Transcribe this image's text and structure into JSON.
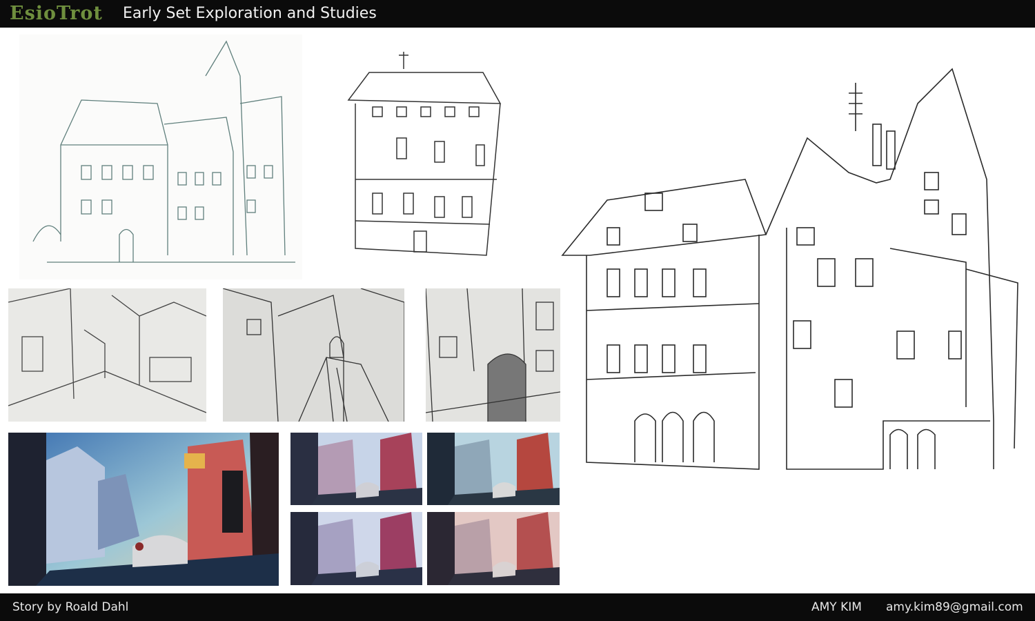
{
  "header": {
    "logo": "EsioTrot",
    "title": "Early Set Exploration and Studies"
  },
  "footer": {
    "credit": "Story by Roald Dahl",
    "author": "AMY KIM",
    "email": "amy.kim89@gmail.com"
  },
  "colors": {
    "bar": "#0b0b0b",
    "logo": "#6f8f3e",
    "text": "#f2f2f2"
  }
}
